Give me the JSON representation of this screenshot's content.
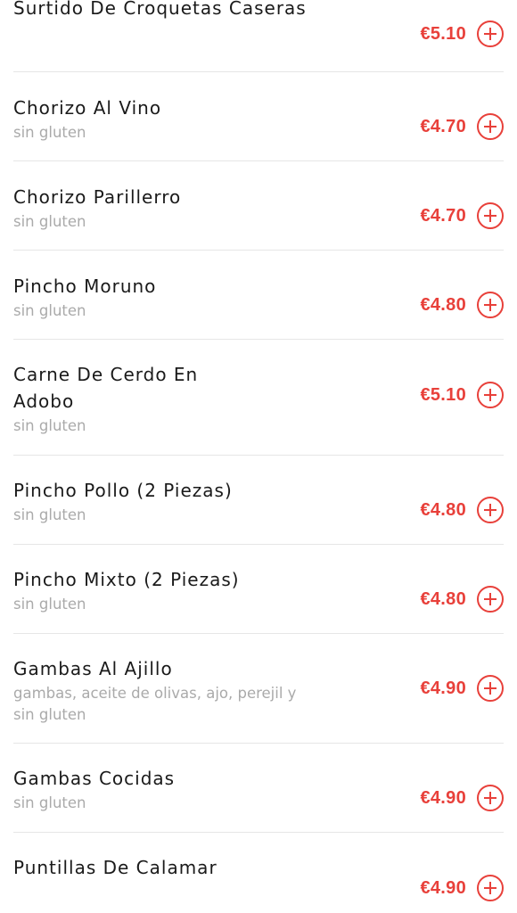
{
  "menu": {
    "items": [
      {
        "name": "Surtido De Croquetas Caseras",
        "description": "",
        "price": "€5.10"
      },
      {
        "name": "Chorizo Al Vino",
        "description": "sin gluten",
        "price": "€4.70"
      },
      {
        "name": "Chorizo Parillerro",
        "description": "sin gluten",
        "price": "€4.70"
      },
      {
        "name": "Pincho Moruno",
        "description": "sin gluten",
        "price": "€4.80"
      },
      {
        "name": "Carne De Cerdo En Adobo",
        "description": "sin gluten",
        "price": "€5.10"
      },
      {
        "name": "Pincho Pollo (2 Piezas)",
        "description": "sin gluten",
        "price": "€4.80"
      },
      {
        "name": "Pincho Mixto (2 Piezas)",
        "description": "sin gluten",
        "price": "€4.80"
      },
      {
        "name": "Gambas Al Ajillo",
        "description": "gambas, aceite de olivas, ajo, perejil y sin gluten",
        "price": "€4.90"
      },
      {
        "name": "Gambas Cocidas",
        "description": "sin gluten",
        "price": "€4.90"
      },
      {
        "name": "Puntillas De Calamar",
        "description": "",
        "price": "€4.90"
      }
    ],
    "add_icon": "plus-circle-icon",
    "accent_color": "#e8403a"
  }
}
